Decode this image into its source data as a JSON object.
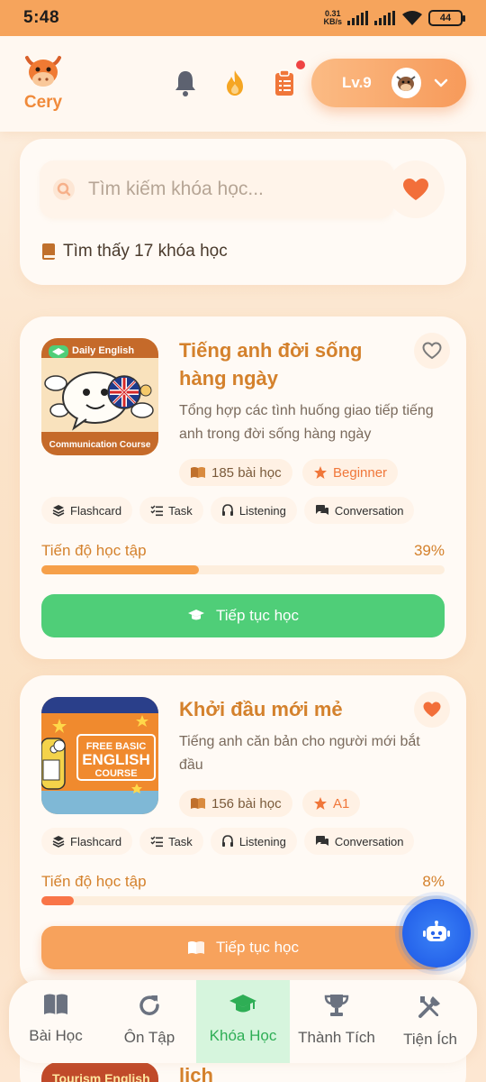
{
  "status_bar": {
    "time": "5:48",
    "net_speed": "0.31",
    "net_unit": "KB/s",
    "battery": "44"
  },
  "header": {
    "app_name": "Cery",
    "level_label": "Lv.9"
  },
  "search": {
    "placeholder": "Tìm kiếm khóa học...",
    "found_text": "Tìm thấy 17 khóa học"
  },
  "courses": [
    {
      "title": "Tiếng anh đời sống hàng ngày",
      "description": "Tổng hợp các tình huống giao tiếp tiếng anh trong đời sống hàng ngày",
      "lessons": "185 bài học",
      "level": "Beginner",
      "favorite": false,
      "thumb_top": "Daily English",
      "thumb_bottom": "Communication Course",
      "tags": [
        "Flashcard",
        "Task",
        "Listening",
        "Conversation"
      ],
      "progress_label": "Tiến độ học tập",
      "progress_text": "39%",
      "progress": 0.39,
      "button_label": "Tiếp tục học",
      "button_color": "#4fce78"
    },
    {
      "title": "Khởi đầu mới mẻ",
      "description": "Tiếng anh căn bản cho người mới bắt đầu",
      "lessons": "156 bài học",
      "level": "A1",
      "favorite": true,
      "thumb_top": "FREE BASIC",
      "thumb_mid": "ENGLISH",
      "thumb_bottom": "COURSE",
      "tags": [
        "Flashcard",
        "Task",
        "Listening",
        "Conversation"
      ],
      "progress_label": "Tiến độ học tập",
      "progress_text": "8%",
      "progress": 0.08,
      "button_label": "Tiếp tục học",
      "button_color": "#f7a25c"
    }
  ],
  "peek": {
    "thumb_text": "Tourism English",
    "title_fragment": "lịch"
  },
  "bottom_nav": [
    {
      "label": "Bài Học",
      "icon": "book-icon",
      "active": false
    },
    {
      "label": "Ôn Tập",
      "icon": "refresh-icon",
      "active": false
    },
    {
      "label": "Khóa Học",
      "icon": "graduation-cap-icon",
      "active": true
    },
    {
      "label": "Thành Tích",
      "icon": "trophy-icon",
      "active": false
    },
    {
      "label": "Tiện Ích",
      "icon": "tools-icon",
      "active": false
    }
  ],
  "colors": {
    "accent": "#f08a3a",
    "title": "#d4812c",
    "green": "#4fce78",
    "active_nav": "#2eae55"
  }
}
